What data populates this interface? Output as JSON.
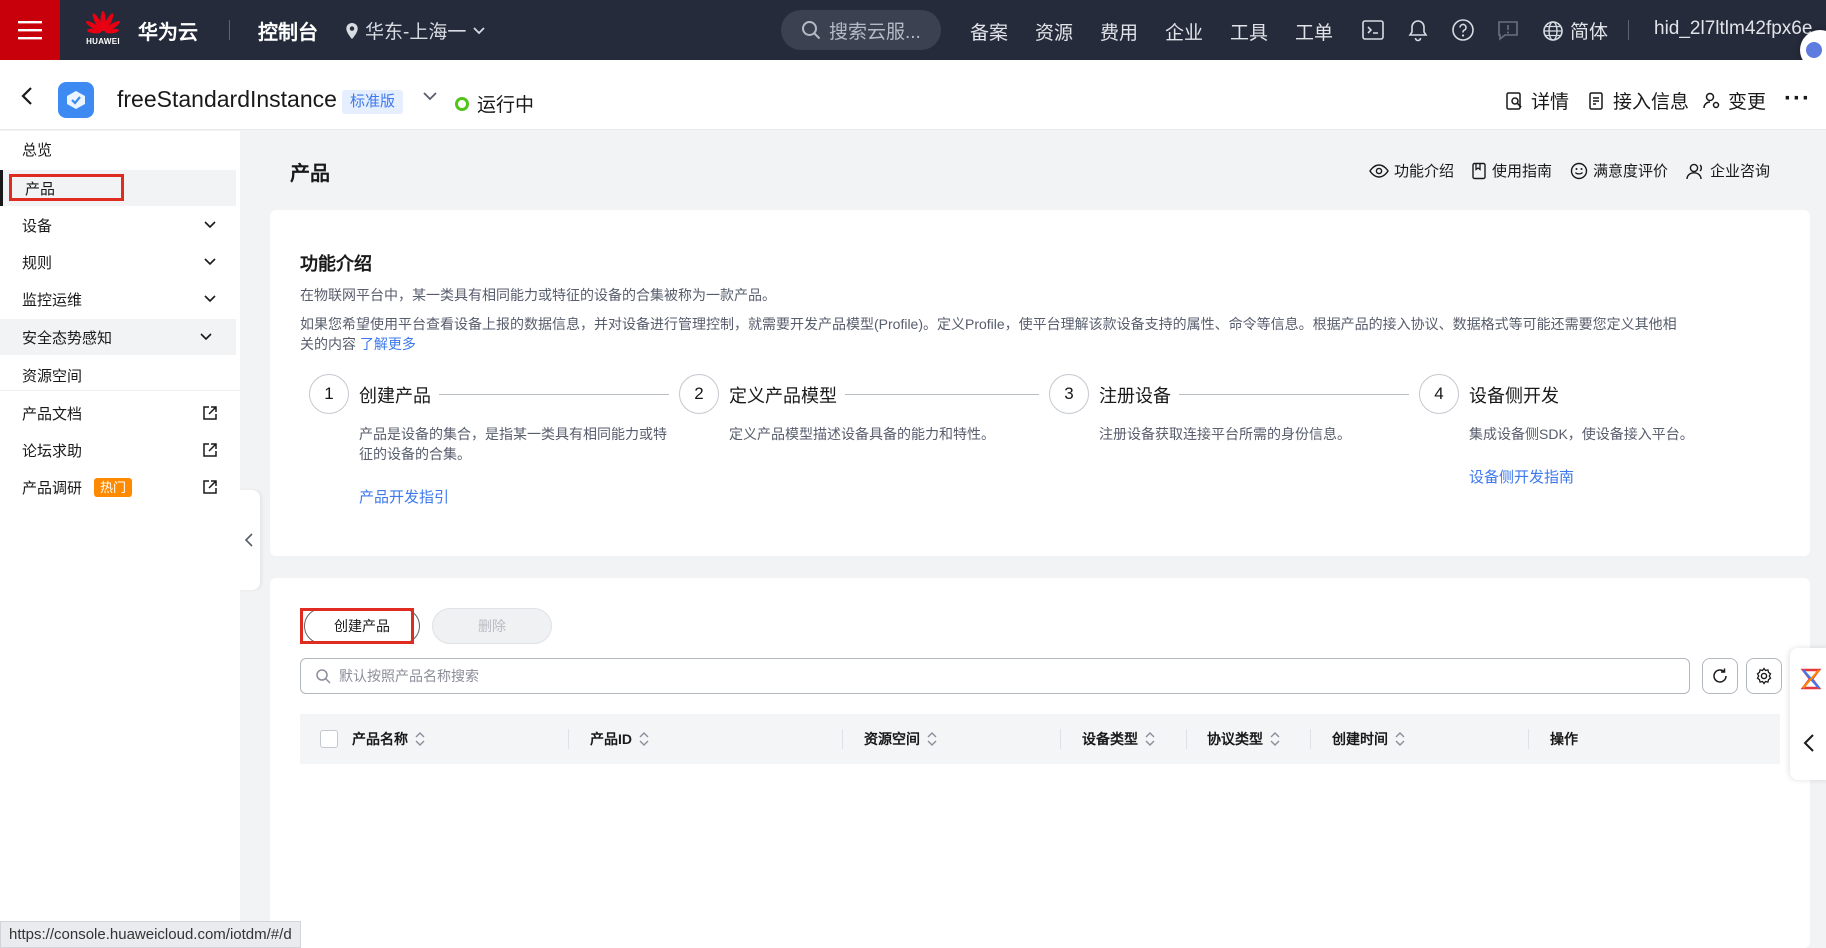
{
  "topnav": {
    "brand": "华为云",
    "logo_text": "HUAWEI",
    "console": "控制台",
    "region": "华东-上海一",
    "search_placeholder": "搜索云服...",
    "links": [
      "备案",
      "资源",
      "费用",
      "企业",
      "工具",
      "工单"
    ],
    "language": "简体",
    "username": "hid_2l7ltlm42fpx6e"
  },
  "instance": {
    "name": "freeStandardInstance",
    "edition": "标准版",
    "status": "运行中",
    "actions": [
      "详情",
      "接入信息",
      "变更"
    ]
  },
  "sidebar": {
    "items": [
      {
        "label": "总览"
      },
      {
        "label": "产品"
      },
      {
        "label": "设备"
      },
      {
        "label": "规则"
      },
      {
        "label": "监控运维"
      },
      {
        "label": "安全态势感知"
      },
      {
        "label": "资源空间"
      },
      {
        "label": "产品文档"
      },
      {
        "label": "论坛求助"
      },
      {
        "label": "产品调研",
        "badge": "热门"
      }
    ]
  },
  "page": {
    "title": "产品",
    "actions": [
      "功能介绍",
      "使用指南",
      "满意度评价",
      "企业咨询"
    ]
  },
  "intro": {
    "title": "功能介绍",
    "line1": "在物联网平台中，某一类具有相同能力或特征的设备的合集被称为一款产品。",
    "line2": "如果您希望使用平台查看设备上报的数据信息，并对设备进行管理控制，就需要开发产品模型(Profile)。定义Profile，使平台理解该款设备支持的属性、命令等信息。根据产品的接入协议、数据格式等可能还需要您定义其他相",
    "line3": "关的内容",
    "learn_more": "了解更多",
    "steps": [
      {
        "num": "1",
        "title": "创建产品",
        "desc": "产品是设备的集合，是指某一类具有相同能力或特征的设备的合集。",
        "link": "产品开发指引"
      },
      {
        "num": "2",
        "title": "定义产品模型",
        "desc": "定义产品模型描述设备具备的能力和特性。",
        "link": ""
      },
      {
        "num": "3",
        "title": "注册设备",
        "desc": "注册设备获取连接平台所需的身份信息。",
        "link": ""
      },
      {
        "num": "4",
        "title": "设备侧开发",
        "desc": "集成设备侧SDK，使设备接入平台。",
        "link": "设备侧开发指南"
      }
    ]
  },
  "list": {
    "create_label": "创建产品",
    "delete_label": "删除",
    "search_placeholder": "默认按照产品名称搜索",
    "columns": [
      "产品名称",
      "产品ID",
      "资源空间",
      "设备类型",
      "协议类型",
      "创建时间",
      "操作"
    ]
  },
  "statusbar": {
    "url": "https://console.huaweicloud.com/iotdm/#/d"
  },
  "colors": {
    "topnav": "#252b3a",
    "brand_red": "#c7000b",
    "link": "#3d79ec",
    "highlight": "#e02b20",
    "hot": "#ff8a00"
  }
}
